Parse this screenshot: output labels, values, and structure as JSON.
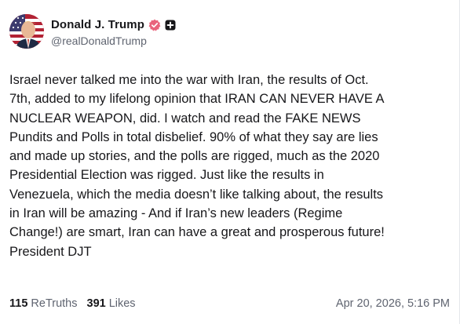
{
  "author": {
    "display_name": "Donald J. Trump",
    "handle": "@realDonaldTrump",
    "verified_icon": "verified-check-icon",
    "verified_color": "#e9637c",
    "badge_icon": "plus-badge-icon"
  },
  "post": {
    "text": "Israel never talked me into the war with Iran, the results of Oct.\n7th, added to my lifelong opinion that IRAN CAN NEVER HAVE A\nNUCLEAR WEAPON, did. I watch and read the FAKE NEWS\nPundits and Polls in total disbelief. 90% of what they say are lies\nand made up stories, and the polls are rigged, much as the 2020\nPresidential Election was rigged. Just like the results in\nVenezuela, which the media doesn’t like talking about, the results\nin Iran will be amazing - And if Iran’s new leaders (Regime\nChange!) are smart, Iran can have a great and prosperous future!\nPresident DJT",
    "retruths_count": "115",
    "retruths_label": "ReTruths",
    "likes_count": "391",
    "likes_label": "Likes",
    "timestamp": "Apr 20, 2026, 5:16 PM"
  },
  "colors": {
    "text": "#17171a",
    "muted": "#5f6470",
    "accent": "#e9637c"
  }
}
